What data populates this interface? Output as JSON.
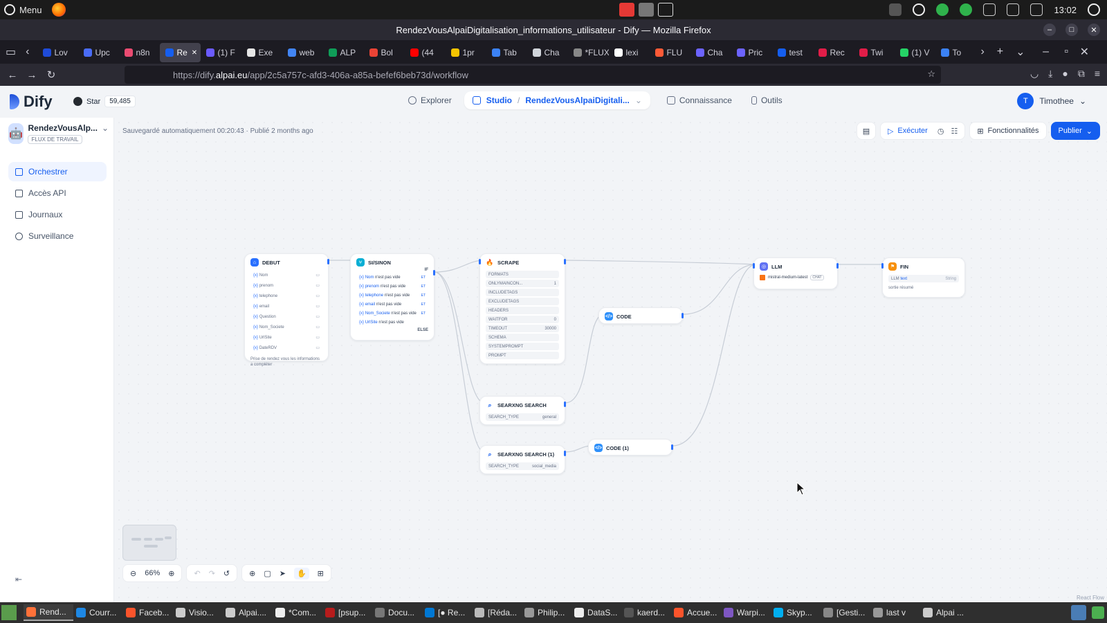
{
  "system": {
    "menu_label": "Menu",
    "clock": "13:02"
  },
  "window": {
    "title": "RendezVousAlpaiDigitalisation_informations_utilisateur - Dify — Mozilla Firefox"
  },
  "tabs": [
    {
      "label": "Lov",
      "color": "#1f4bd8"
    },
    {
      "label": "Upc",
      "color": "#4a6cf7"
    },
    {
      "label": "n8n",
      "color": "#ea4b71"
    },
    {
      "label": "Re",
      "color": "#155eef",
      "active": true
    },
    {
      "label": "(1) F",
      "color": "#6b5bff"
    },
    {
      "label": "Exe",
      "color": "#e6e6e6"
    },
    {
      "label": "web",
      "color": "#4285f4"
    },
    {
      "label": "ALP",
      "color": "#0f9d58"
    },
    {
      "label": "Bol",
      "color": "#ea4335"
    },
    {
      "label": "(44",
      "color": "#ff0000"
    },
    {
      "label": "1pr",
      "color": "#f5c400"
    },
    {
      "label": "Tab",
      "color": "#3b82f6"
    },
    {
      "label": "Cha",
      "color": "#d1d5db"
    },
    {
      "label": "*FLUX_",
      "color": "#888888"
    },
    {
      "label": "lexi",
      "color": "#ffffff"
    },
    {
      "label": "FLU",
      "color": "#ff5a36"
    },
    {
      "label": "Cha",
      "color": "#6c63ff"
    },
    {
      "label": "Pric",
      "color": "#6c63ff"
    },
    {
      "label": "test",
      "color": "#155eef"
    },
    {
      "label": "Rec",
      "color": "#e11d48"
    },
    {
      "label": "Twi",
      "color": "#e11d48"
    },
    {
      "label": "(1) V",
      "color": "#25d366"
    },
    {
      "label": "To",
      "color": "#3b82f6"
    }
  ],
  "nav": {
    "url_prefix": "https://dify.",
    "url_host": "alpai.eu",
    "url_path": "/app/2c5a757c-afd3-406a-a85a-befef6beb73d/workflow"
  },
  "header": {
    "logo": "Dify",
    "star_label": "Star",
    "star_count": "59,485",
    "explorer": "Explorer",
    "studio": "Studio",
    "app_name": "RendezVousAlpaiDigitali...",
    "knowledge": "Connaissance",
    "tools": "Outils",
    "user_initial": "T",
    "user_name": "Timothee"
  },
  "sidebar": {
    "app_name": "RendezVousAlp...",
    "app_type": "FLUX DE TRAVAIL",
    "items": [
      {
        "label": "Orchestrer",
        "active": true
      },
      {
        "label": "Accès API"
      },
      {
        "label": "Journaux"
      },
      {
        "label": "Surveillance"
      }
    ]
  },
  "canvas": {
    "saved_status": "Sauvegardé automatiquement 00:20:43 · Publié 2 months ago",
    "run_label": "Exécuter",
    "features_label": "Fonctionnalités",
    "publish_label": "Publier",
    "zoom_level": "66%",
    "react_flow": "React Flow"
  },
  "nodes": {
    "debut": {
      "title": "DEBUT",
      "vars": [
        "Nom",
        "prenom",
        "telephone",
        "email",
        "Question",
        "Nom_Societe",
        "UrlSite",
        "DateRDV"
      ],
      "description": "Prise de rendez vous les informations a compléter"
    },
    "ifelse": {
      "title": "SI/SINON",
      "if_label": "IF",
      "conditions": [
        {
          "var": "Nom",
          "text": "n'est pas vide"
        },
        {
          "var": "prenom",
          "text": "n'est pas vide"
        },
        {
          "var": "telephone",
          "text": "n'est pas vide"
        },
        {
          "var": "email",
          "text": "n'est pas vide"
        },
        {
          "var": "Nom_Societe",
          "text": "n'est pas vide"
        },
        {
          "var": "UrlSite",
          "text": "n'est pas vide"
        }
      ],
      "and_label": "ET",
      "else_label": "ELSE"
    },
    "scrape": {
      "title": "SCRAPE",
      "params": [
        {
          "k": "FORMATS",
          "v": ""
        },
        {
          "k": "ONLYMAINCON...",
          "v": "1"
        },
        {
          "k": "INCLUDETAGS",
          "v": ""
        },
        {
          "k": "EXCLUDETAGS",
          "v": ""
        },
        {
          "k": "HEADERS",
          "v": ""
        },
        {
          "k": "WAITFOR",
          "v": "0"
        },
        {
          "k": "TIMEOUT",
          "v": "30000"
        },
        {
          "k": "SCHEMA",
          "v": ""
        },
        {
          "k": "SYSTEMPROMPT",
          "v": ""
        },
        {
          "k": "PROMPT",
          "v": ""
        }
      ]
    },
    "code": {
      "title": "CODE"
    },
    "code1": {
      "title": "CODE (1)"
    },
    "search": {
      "title": "SEARXNG SEARCH",
      "param": "SEARCH_TYPE",
      "value": "general"
    },
    "search1": {
      "title": "SEARXNG SEARCH (1)",
      "param": "SEARCH_TYPE",
      "value": "social_media"
    },
    "llm": {
      "title": "LLM",
      "model": "mistral-medium-latest",
      "badge": "CHAT"
    },
    "fin": {
      "title": "FIN",
      "source": "LLM",
      "var": "text",
      "type": "String",
      "note": "sortie résumé"
    }
  },
  "taskbar": [
    {
      "label": "Rend...",
      "color": "#ff7139",
      "active": true
    },
    {
      "label": "Courr...",
      "color": "#1e88e5"
    },
    {
      "label": "Faceb...",
      "color": "#fb542b"
    },
    {
      "label": "Visio...",
      "color": "#cccccc"
    },
    {
      "label": "Alpai....",
      "color": "#cccccc"
    },
    {
      "label": "*Com...",
      "color": "#eeeeee"
    },
    {
      "label": "[psup...",
      "color": "#b71c1c"
    },
    {
      "label": "Docu...",
      "color": "#777777"
    },
    {
      "label": "[● Re...",
      "color": "#0078d4"
    },
    {
      "label": "[Réda...",
      "color": "#bbbbbb"
    },
    {
      "label": "Philip...",
      "color": "#999999"
    },
    {
      "label": "DataS...",
      "color": "#eeeeee"
    },
    {
      "label": "kaerd...",
      "color": "#555555"
    },
    {
      "label": "Accue...",
      "color": "#fb542b"
    },
    {
      "label": "Warpi...",
      "color": "#7e57c2"
    },
    {
      "label": "Skyp...",
      "color": "#00aff0"
    },
    {
      "label": "[Gesti...",
      "color": "#888888"
    },
    {
      "label": "last v",
      "color": "#999999"
    },
    {
      "label": "Alpai ...",
      "color": "#cccccc"
    }
  ]
}
